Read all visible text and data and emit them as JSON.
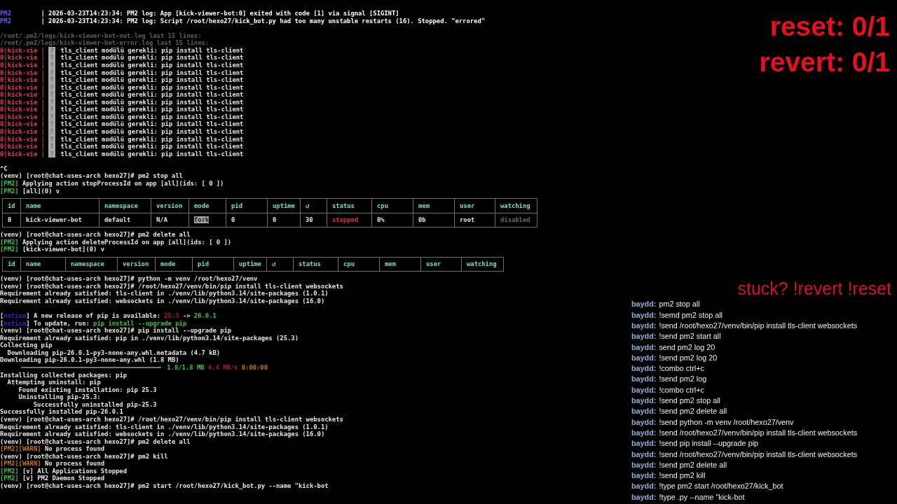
{
  "terminal": {
    "lines": [
      {
        "kind": "text",
        "parts": [
          {
            "text": "PM2",
            "kind": "process"
          },
          {
            "text": "| 2026-03-23T14:23:34: PM2 log: App [kick-viewer-bot:0] exited with code [1] via signal [SIGINT]",
            "kind": "message"
          }
        ]
      },
      {
        "kind": "text",
        "parts": [
          {
            "text": "PM2",
            "kind": "process"
          },
          {
            "text": "| 2026-03-23T14:23:34: PM2 log: Script /root/hexo27/kick_bot.py had too many unstable restarts (16). Stopped. \"errored\"",
            "kind": "message"
          }
        ]
      },
      {
        "kind": "blank"
      },
      {
        "kind": "text",
        "parts": [
          {
            "text": "/root/.pm2/logs/kick-viewer-bot-out.log last 15 lines:",
            "kind": "path"
          }
        ]
      },
      {
        "kind": "text",
        "parts": [
          {
            "text": "/root/.pm2/logs/kick-viewer-bot-error.log last 15 lines:",
            "kind": "path"
          }
        ]
      },
      {
        "kind": "text",
        "parts": [
          {
            "text": "0|kick-vie |",
            "kind": "app"
          },
          {
            "text": "?",
            "kind": "glyph"
          },
          {
            "text": "tls_client modülü gerekli: pip install tls-client",
            "kind": "plain"
          }
        ]
      },
      {
        "kind": "text",
        "parts": [
          {
            "text": "0|kick-vie |",
            "kind": "app"
          },
          {
            "text": "?",
            "kind": "glyph"
          },
          {
            "text": "tls_client modülü gerekli: pip install tls-client",
            "kind": "plain"
          }
        ]
      },
      {
        "kind": "text",
        "parts": [
          {
            "text": "0|kick-vie |",
            "kind": "app"
          },
          {
            "text": "?",
            "kind": "glyph"
          },
          {
            "text": "tls_client modülü gerekli: pip install tls-client",
            "kind": "plain"
          }
        ]
      },
      {
        "kind": "text",
        "parts": [
          {
            "text": "0|kick-vie |",
            "kind": "app"
          },
          {
            "text": "?",
            "kind": "glyph"
          },
          {
            "text": "tls_client modülü gerekli: pip install tls-client",
            "kind": "plain"
          }
        ]
      },
      {
        "kind": "text",
        "parts": [
          {
            "text": "0|kick-vie |",
            "kind": "app"
          },
          {
            "text": "?",
            "kind": "glyph"
          },
          {
            "text": "tls_client modülü gerekli: pip install tls-client",
            "kind": "plain"
          }
        ]
      },
      {
        "kind": "text",
        "parts": [
          {
            "text": "0|kick-vie |",
            "kind": "app"
          },
          {
            "text": "?",
            "kind": "glyph"
          },
          {
            "text": "tls_client modülü gerekli: pip install tls-client",
            "kind": "plain"
          }
        ]
      },
      {
        "kind": "text",
        "parts": [
          {
            "text": "0|kick-vie |",
            "kind": "app"
          },
          {
            "text": "?",
            "kind": "glyph"
          },
          {
            "text": "tls_client modülü gerekli: pip install tls-client",
            "kind": "plain"
          }
        ]
      },
      {
        "kind": "text",
        "parts": [
          {
            "text": "0|kick-vie |",
            "kind": "app"
          },
          {
            "text": "?",
            "kind": "glyph"
          },
          {
            "text": "tls_client modülü gerekli: pip install tls-client",
            "kind": "plain"
          }
        ]
      },
      {
        "kind": "text",
        "parts": [
          {
            "text": "0|kick-vie |",
            "kind": "app"
          },
          {
            "text": "?",
            "kind": "glyph"
          },
          {
            "text": "tls_client modülü gerekli: pip install tls-client",
            "kind": "plain"
          }
        ]
      },
      {
        "kind": "text",
        "parts": [
          {
            "text": "0|kick-vie |",
            "kind": "app"
          },
          {
            "text": "?",
            "kind": "glyph"
          },
          {
            "text": "tls_client modülü gerekli: pip install tls-client",
            "kind": "plain"
          }
        ]
      },
      {
        "kind": "text",
        "parts": [
          {
            "text": "0|kick-vie |",
            "kind": "app"
          },
          {
            "text": "?",
            "kind": "glyph"
          },
          {
            "text": "tls_client modülü gerekli: pip install tls-client",
            "kind": "plain"
          }
        ]
      },
      {
        "kind": "text",
        "parts": [
          {
            "text": "0|kick-vie |",
            "kind": "app"
          },
          {
            "text": "?",
            "kind": "glyph"
          },
          {
            "text": "tls_client modülü gerekli: pip install tls-client",
            "kind": "plain"
          }
        ]
      },
      {
        "kind": "text",
        "parts": [
          {
            "text": "0|kick-vie |",
            "kind": "app"
          },
          {
            "text": "?",
            "kind": "glyph"
          },
          {
            "text": "tls_client modülü gerekli: pip install tls-client",
            "kind": "plain"
          }
        ]
      },
      {
        "kind": "text",
        "parts": [
          {
            "text": "0|kick-vie |",
            "kind": "app"
          },
          {
            "text": "?",
            "kind": "glyph"
          },
          {
            "text": "tls_client modülü gerekli: pip install tls-client",
            "kind": "plain"
          }
        ]
      },
      {
        "kind": "text",
        "parts": [
          {
            "text": "0|kick-vie |",
            "kind": "app"
          },
          {
            "text": "?",
            "kind": "glyph"
          },
          {
            "text": "tls_client modülü gerekli: pip install tls-client",
            "kind": "plain"
          }
        ]
      },
      {
        "kind": "blank"
      },
      {
        "kind": "text",
        "parts": [
          {
            "text": "^C",
            "kind": "plain"
          }
        ]
      },
      {
        "kind": "text",
        "parts": [
          {
            "text": "(venv) [root@chat-uses-arch hexo27]# pm2 stop all",
            "kind": "plain"
          }
        ]
      },
      {
        "kind": "text",
        "parts": [
          {
            "text": "[PM2]",
            "kind": "ok"
          },
          {
            "text": "Applying action stopProcessId on app [all](ids: [ 0 ])",
            "kind": "plain"
          }
        ]
      },
      {
        "kind": "text",
        "parts": [
          {
            "text": "[PM2]",
            "kind": "ok"
          },
          {
            "text": "[all](0) v",
            "kind": "plain"
          }
        ]
      },
      {
        "kind": "table",
        "columns": [
          "id",
          "name",
          "namespace",
          "version",
          "mode",
          "pid",
          "uptime",
          "↺",
          "status",
          "cpu",
          "mem",
          "user",
          "watching"
        ],
        "rows": [
          {
            "cells": [
              {
                "text": "0",
                "kind": "plain"
              },
              {
                "text": "kick-viewer-bot",
                "kind": "plain"
              },
              {
                "text": "default",
                "kind": "plain"
              },
              {
                "text": "N/A",
                "kind": "plain"
              },
              {
                "text": "fork",
                "kind": "mode"
              },
              {
                "text": "0",
                "kind": "plain"
              },
              {
                "text": "0",
                "kind": "plain"
              },
              {
                "text": "30",
                "kind": "plain"
              },
              {
                "text": "stopped",
                "kind": "stopped"
              },
              {
                "text": "0%",
                "kind": "plain"
              },
              {
                "text": "0b",
                "kind": "plain"
              },
              {
                "text": "root",
                "kind": "plain"
              },
              {
                "text": "disabled",
                "kind": "muted"
              }
            ]
          }
        ]
      },
      {
        "kind": "text",
        "parts": [
          {
            "text": "(venv) [root@chat-uses-arch hexo27]# pm2 delete all",
            "kind": "plain"
          }
        ]
      },
      {
        "kind": "text",
        "parts": [
          {
            "text": "[PM2]",
            "kind": "ok"
          },
          {
            "text": "Applying action deleteProcessId on app [all](ids: [ 0 ])",
            "kind": "plain"
          }
        ]
      },
      {
        "kind": "text",
        "parts": [
          {
            "text": "[PM2]",
            "kind": "ok"
          },
          {
            "text": "[kick-viewer-bot](0) v",
            "kind": "plain"
          }
        ]
      },
      {
        "kind": "table",
        "columns": [
          "id",
          "name",
          "namespace",
          "version",
          "mode",
          "pid",
          "uptime",
          "↺",
          "status",
          "cpu",
          "mem",
          "user",
          "watching"
        ]
      },
      {
        "kind": "text",
        "parts": [
          {
            "text": "(venv) [root@chat-uses-arch hexo27]# python -m venv /root/hexo27/venv",
            "kind": "plain"
          }
        ]
      },
      {
        "kind": "text",
        "parts": [
          {
            "text": "(venv) [root@chat-uses-arch hexo27]# /root/hexo27/venv/bin/pip install tls-client websockets",
            "kind": "plain"
          }
        ]
      },
      {
        "kind": "text",
        "parts": [
          {
            "text": "Requirement already satisfied: tls-client in ./venv/lib/python3.14/site-packages (1.0.1)",
            "kind": "plain"
          }
        ]
      },
      {
        "kind": "text",
        "parts": [
          {
            "text": "Requirement already satisfied: websockets in ./venv/lib/python3.14/site-packages (16.0)",
            "kind": "plain"
          }
        ]
      },
      {
        "kind": "blank"
      },
      {
        "kind": "text",
        "parts": [
          {
            "text": "[",
            "kind": "bracket"
          },
          {
            "text": "notice",
            "kind": "notice"
          },
          {
            "text": "] A new release of pip is available:",
            "kind": "plain"
          },
          {
            "text": "25.3",
            "kind": "error"
          },
          {
            "text": "->",
            "kind": "plain"
          },
          {
            "text": "26.0.1",
            "kind": "ok"
          }
        ]
      },
      {
        "kind": "text",
        "parts": [
          {
            "text": "[",
            "kind": "bracket"
          },
          {
            "text": "notice",
            "kind": "notice"
          },
          {
            "text": "] To update, run:",
            "kind": "plain"
          },
          {
            "text": "pip install --upgrade pip",
            "kind": "ok"
          }
        ]
      },
      {
        "kind": "text",
        "parts": [
          {
            "text": "(venv) [root@chat-uses-arch hexo27]# pip install --upgrade pip",
            "kind": "plain"
          }
        ]
      },
      {
        "kind": "text",
        "parts": [
          {
            "text": "Requirement already satisfied: pip in ./venv/lib/python3.14/site-packages (25.3)",
            "kind": "plain"
          }
        ]
      },
      {
        "kind": "text",
        "parts": [
          {
            "text": "Collecting pip",
            "kind": "plain"
          }
        ]
      },
      {
        "kind": "text",
        "parts": [
          {
            "text": "Downloading pip-26.0.1-py3-none-any.whl.metadata (4.7 kB)",
            "kind": "step"
          }
        ]
      },
      {
        "kind": "text",
        "parts": [
          {
            "text": "Downloading pip-26.0.1-py3-none-any.whl (1.8 MB)",
            "kind": "plain"
          }
        ]
      },
      {
        "kind": "progress",
        "level": 1,
        "parts": [
          {
            "text": "1.8/1.8 MB",
            "kind": "ok"
          },
          {
            "text": "4.4 MB/s",
            "kind": "error"
          },
          {
            "text": "0:00:00",
            "kind": "warn"
          }
        ]
      },
      {
        "kind": "text",
        "parts": [
          {
            "text": "Installing collected packages: pip",
            "kind": "plain"
          }
        ]
      },
      {
        "kind": "text",
        "parts": [
          {
            "text": "Attempting uninstall: pip",
            "kind": "step"
          }
        ]
      },
      {
        "kind": "text",
        "parts": [
          {
            "text": "Found existing installation: pip 25.3",
            "kind": "detail"
          }
        ]
      },
      {
        "kind": "text",
        "parts": [
          {
            "text": "Uninstalling pip-25.3:",
            "kind": "detail"
          }
        ]
      },
      {
        "kind": "text",
        "parts": [
          {
            "text": "Successfully uninstalled pip-25.3",
            "kind": "result"
          }
        ]
      },
      {
        "kind": "text",
        "parts": [
          {
            "text": "Successfully installed pip-26.0.1",
            "kind": "plain"
          }
        ]
      },
      {
        "kind": "text",
        "parts": [
          {
            "text": "(venv) [root@chat-uses-arch hexo27]# /root/hexo27/venv/bin/pip install tls-client websockets",
            "kind": "plain"
          }
        ]
      },
      {
        "kind": "text",
        "parts": [
          {
            "text": "Requirement already satisfied: tls-client in ./venv/lib/python3.14/site-packages (1.0.1)",
            "kind": "plain"
          }
        ]
      },
      {
        "kind": "text",
        "parts": [
          {
            "text": "Requirement already satisfied: websockets in ./venv/lib/python3.14/site-packages (16.0)",
            "kind": "plain"
          }
        ]
      },
      {
        "kind": "text",
        "parts": [
          {
            "text": "(venv) [root@chat-uses-arch hexo27]# pm2 delete all",
            "kind": "plain"
          }
        ]
      },
      {
        "kind": "text",
        "parts": [
          {
            "text": "[PM2][WARN]",
            "kind": "warn"
          },
          {
            "text": "No process found",
            "kind": "plain"
          }
        ]
      },
      {
        "kind": "text",
        "parts": [
          {
            "text": "(venv) [root@chat-uses-arch hexo27]# pm2 kill",
            "kind": "plain"
          }
        ]
      },
      {
        "kind": "text",
        "parts": [
          {
            "text": "[PM2][WARN]",
            "kind": "warn"
          },
          {
            "text": "No process found",
            "kind": "plain"
          }
        ]
      },
      {
        "kind": "text",
        "parts": [
          {
            "text": "[PM2]",
            "kind": "ok"
          },
          {
            "text": "[v] All Applications Stopped",
            "kind": "plain"
          }
        ]
      },
      {
        "kind": "text",
        "parts": [
          {
            "text": "[PM2]",
            "kind": "ok"
          },
          {
            "text": "[v] PM2 Daemon Stopped",
            "kind": "plain"
          }
        ]
      },
      {
        "kind": "text",
        "parts": [
          {
            "text": "(venv) [root@chat-uses-arch hexo27]# pm2 start /root/hexo27/kick_bot.py --name \"kick-bot",
            "kind": "plain"
          }
        ]
      }
    ]
  },
  "counters": [
    "reset: 0/1",
    "revert: 0/1"
  ],
  "hint": "stuck? !revert !reset",
  "chat": [
    {
      "user": "baydd:",
      "message": "pm2 stop all"
    },
    {
      "user": "baydd:",
      "message": "!semd pm2 stop all"
    },
    {
      "user": "baydd:",
      "message": "!send /root/hexo27/venv/bin/pip install tls-client websockets"
    },
    {
      "user": "baydd:",
      "message": "!send pm2 start all"
    },
    {
      "user": "baydd:",
      "message": "send pm2 log 20"
    },
    {
      "user": "baydd:",
      "message": "!send pm2 log 20"
    },
    {
      "user": "baydd:",
      "message": "!combo ctrl+c"
    },
    {
      "user": "baydd:",
      "message": "!send pm2 log"
    },
    {
      "user": "baydd:",
      "message": "!combo ctrl+c"
    },
    {
      "user": "baydd:",
      "message": "!send pm2 stop all"
    },
    {
      "user": "baydd:",
      "message": "!send pm2 delete all"
    },
    {
      "user": "baydd:",
      "message": "!send python -m venv /root/hexo27/venv"
    },
    {
      "user": "baydd:",
      "message": "!send /root/hexo27/venv/bin/pip install tls-client websockets"
    },
    {
      "user": "baydd:",
      "message": "!send pip install --upgrade pip"
    },
    {
      "user": "baydd:",
      "message": "!send /root/hexo27/venv/bin/pip install tls-client websockets"
    },
    {
      "user": "baydd:",
      "message": "!send pm2 delete all"
    },
    {
      "user": "baydd:",
      "message": "!send pm2 kill"
    },
    {
      "user": "baydd:",
      "message": "!type pm2 start /root/hexo27/kick_bot"
    },
    {
      "user": "baydd:",
      "message": "!type .py --name \"kick-bot"
    }
  ]
}
